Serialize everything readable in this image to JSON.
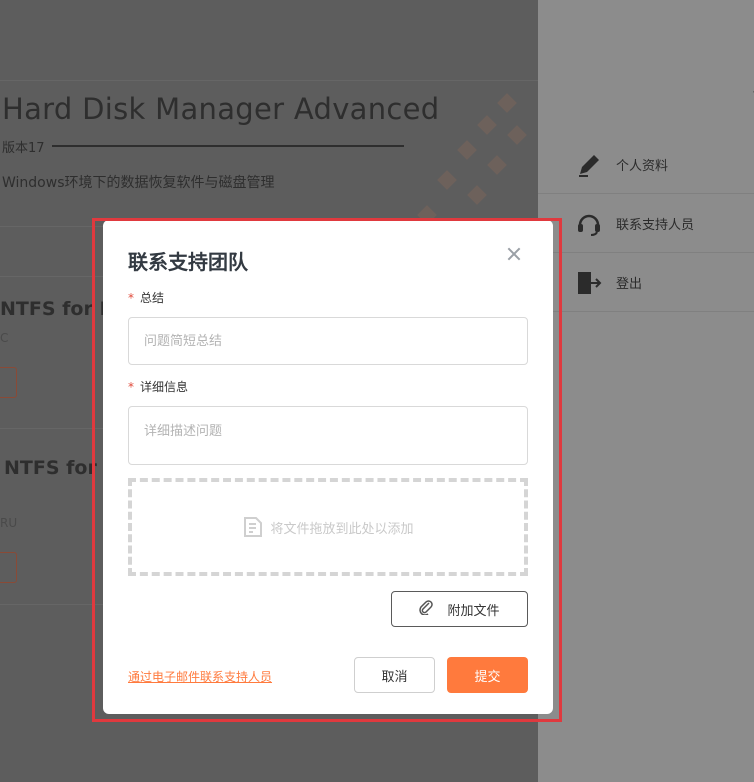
{
  "background": {
    "product_title": "Hard Disk Manager Advanced",
    "version": "版本17",
    "description": "Windows环境下的数据恢复软件与磁盘管理",
    "products": [
      {
        "name": "NTFS for Ma",
        "sub": "C"
      },
      {
        "name": "NTFS for W",
        "sub": "RU"
      }
    ]
  },
  "side_menu": {
    "items": [
      {
        "label": "个人资料",
        "icon": "pen-icon"
      },
      {
        "label": "联系支持人员",
        "icon": "headset-icon"
      },
      {
        "label": "登出",
        "icon": "logout-icon"
      }
    ]
  },
  "modal": {
    "title": "联系支持团队",
    "summary_label": "总结",
    "summary_placeholder": "问题简短总结",
    "details_label": "详细信息",
    "details_placeholder": "详细描述问题",
    "dropzone_text": "将文件拖放到此处以添加",
    "attach_label": "附加文件",
    "email_link": "通过电子邮件联系支持人员",
    "cancel_label": "取消",
    "submit_label": "提交"
  },
  "colors": {
    "accent": "#ff7a3d",
    "highlight": "#e0393e",
    "required": "#e04a3a"
  }
}
